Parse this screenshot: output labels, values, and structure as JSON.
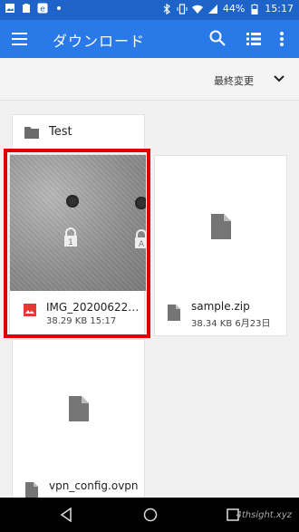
{
  "status": {
    "battery": "44%",
    "time": "15:17"
  },
  "appbar": {
    "title": "ダウンロード"
  },
  "sort": {
    "label": "最終変更"
  },
  "folders": [
    {
      "name": "Test"
    }
  ],
  "files": [
    {
      "name": "IMG_20200622…",
      "size": "38.29 KB",
      "date": "15:17"
    },
    {
      "name": "sample.zip",
      "size": "38.34 KB",
      "date": "6月23日"
    },
    {
      "name": "vpn_config.ovpn"
    }
  ],
  "watermark": "4thsight.xyz",
  "colors": {
    "appbar": "#2979e8",
    "statusbar": "#1e63c7",
    "highlight": "#e00000"
  }
}
